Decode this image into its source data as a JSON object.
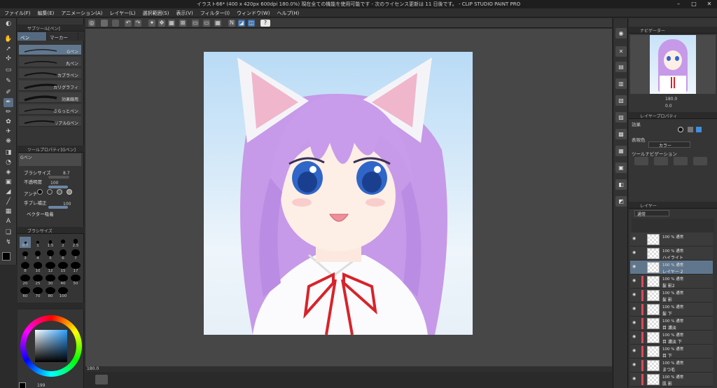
{
  "window": {
    "title": "イラスト66* (400 x 420px 600dpi 180.0%)  現在全ての機能を使用可能です - 次のライセンス更新は 11 日後です。 - CLIP STUDIO PAINT PRO"
  },
  "menu": [
    "ファイル(F)",
    "編集(E)",
    "アニメーション(A)",
    "レイヤー(L)",
    "選択範囲(S)",
    "表示(V)",
    "フィルター(I)",
    "ウィンドウ(W)",
    "ヘルプ(H)"
  ],
  "subtool_panel": {
    "title": "サブツール[ペン]",
    "tabs": [
      "ペン",
      "マーカー"
    ],
    "brushes": [
      "Gペン",
      "丸ペン",
      "カブラペン",
      "カリグラフィ",
      "効果線用",
      "さらっとペン",
      "リアルGペン"
    ]
  },
  "tool_property": {
    "title": "ツールプロパティ[Gペン]",
    "current": "Gペン",
    "brush_size_label": "ブラシサイズ",
    "brush_size_value": "8.7",
    "opacity_label": "不透明度",
    "opacity_value": "100",
    "antialias_label": "アンチ",
    "stabilization_label": "手ブレ補正",
    "stabilization_value": "100",
    "vector_label": "ベクター吸着"
  },
  "brush_size_panel": {
    "title": "ブラシサイズ",
    "sizes": [
      "0.7",
      "1",
      "1.5",
      "2",
      "2.5",
      "3",
      "4",
      "5",
      "6",
      "7",
      "8",
      "10",
      "12",
      "15",
      "17",
      "20",
      "25",
      "30",
      "40",
      "50",
      "60",
      "70",
      "80",
      "100"
    ]
  },
  "color": {
    "main": "#000000",
    "sub": "#ffffff",
    "bottom_value": "199"
  },
  "canvas": {
    "zoom": "180.0"
  },
  "navigator": {
    "title": "ナビゲーター",
    "zoom": "180.0",
    "rotation": "0.0"
  },
  "layer_property": {
    "title": "レイヤープロパティ",
    "effect_label": "効果",
    "expression_color_label": "表現色",
    "expression_color_value": "カラー",
    "ruler_label": "ツールナビゲーション"
  },
  "layers_panel": {
    "tab_label": "レイヤー",
    "blend_mode": "通常",
    "layers": [
      {
        "mode": "100 % 通常",
        "name": ""
      },
      {
        "mode": "100 % 通常",
        "name": "ハイライト"
      },
      {
        "mode": "100 % 通常",
        "name": "レイヤー 2"
      },
      {
        "mode": "100 % 通常",
        "name": "髪 影2"
      },
      {
        "mode": "100 % 通常",
        "name": "髪 影"
      },
      {
        "mode": "100 % 通常",
        "name": "髪 下"
      },
      {
        "mode": "100 % 通常",
        "name": "目 濃淡"
      },
      {
        "mode": "100 % 通常",
        "name": "目 濃淡 下"
      },
      {
        "mode": "100 % 通常",
        "name": "目 下"
      },
      {
        "mode": "100 % 通常",
        "name": "まつ毛"
      },
      {
        "mode": "100 % 通常",
        "name": "肌 影"
      }
    ]
  }
}
